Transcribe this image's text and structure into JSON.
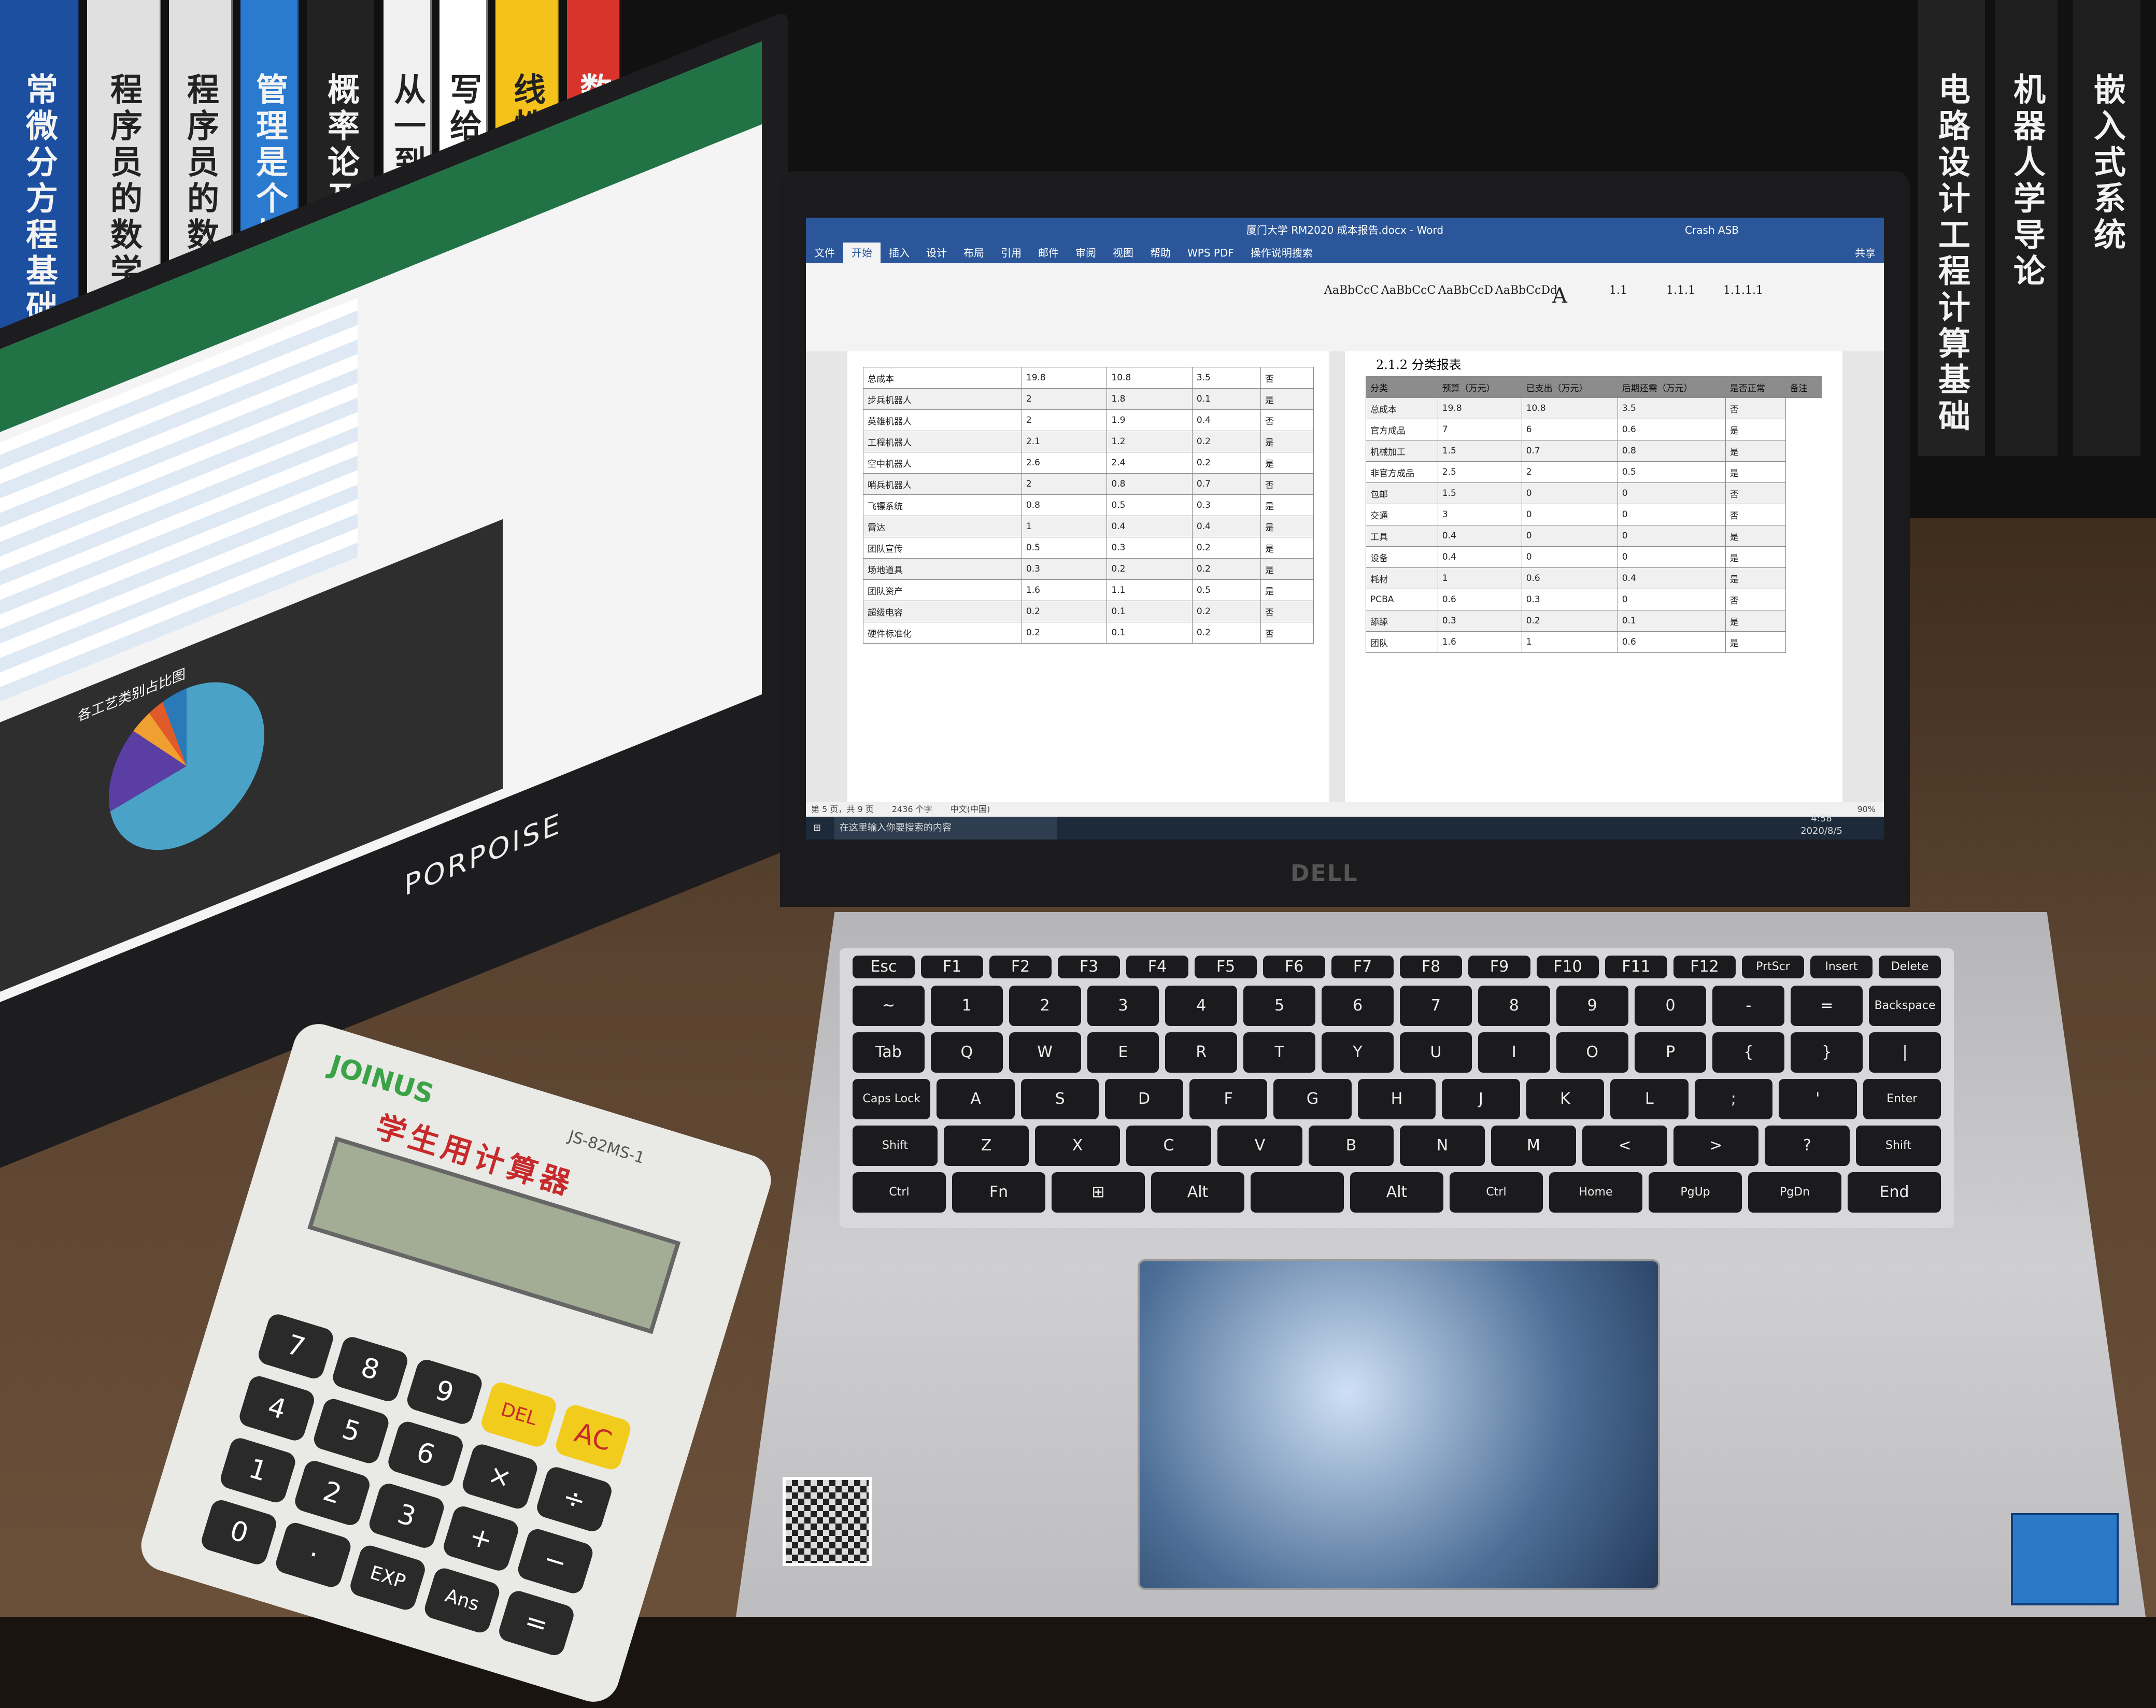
{
  "books": [
    {
      "title": "常微分方程基础",
      "color": "#1c4fa0"
    },
    {
      "title": "程序员的数学",
      "color": "#e0e0e0"
    },
    {
      "title": "程序员的数学",
      "color": "#e0e0e0"
    },
    {
      "title": "管理是个技术活",
      "color": "#2a7ad0"
    },
    {
      "title": "概率论及其应用",
      "color": "#222222"
    },
    {
      "title": "从一到无穷大",
      "color": "#f0f0f0"
    },
    {
      "title": "写给大家看的设计书",
      "color": "#ffffff"
    },
    {
      "title": "线性代数",
      "color": "#f5c21b"
    },
    {
      "title": "数学之美",
      "color": "#d9342b"
    },
    {
      "title": "电路设计工程计算基础",
      "color": "#222222"
    },
    {
      "title": "机器人学导论",
      "color": "#1e1e1e"
    },
    {
      "title": "嵌入式系统",
      "color": "#1e1e1e"
    }
  ],
  "monitor": {
    "brand": "PORPOISE",
    "chart_title": "各工艺类别占比图",
    "ribbon_color": "#217346"
  },
  "laptop": {
    "brand": "DELL",
    "window_title": "厦门大学 RM2020 成本报告.docx - Word",
    "user": "Crash ASB",
    "ribbon_tabs": [
      "文件",
      "开始",
      "插入",
      "设计",
      "布局",
      "引用",
      "邮件",
      "审阅",
      "视图",
      "帮助",
      "WPS PDF",
      "操作说明搜索"
    ],
    "share": "共享",
    "styles": [
      "AaBbCcC",
      "AaBbCcC",
      "AaBbCcD",
      "AaBbCcDd",
      "A",
      "1.1",
      "1.1.1",
      "1.1.1.1"
    ],
    "section_heading": "2.1.2 分类报表",
    "right_table_header": [
      "分类",
      "预算（万元）",
      "已支出（万元）",
      "后期还需（万元）",
      "是否正常",
      "备注"
    ],
    "left_table_rows": [
      [
        "总成本",
        "19.8",
        "10.8",
        "3.5",
        "否"
      ],
      [
        "步兵机器人",
        "2",
        "1.8",
        "0.1",
        "是"
      ],
      [
        "英雄机器人",
        "2",
        "1.9",
        "0.4",
        "否"
      ],
      [
        "工程机器人",
        "2.1",
        "1.2",
        "0.2",
        "是"
      ],
      [
        "空中机器人",
        "2.6",
        "2.4",
        "0.2",
        "是"
      ],
      [
        "哨兵机器人",
        "2",
        "0.8",
        "0.7",
        "否"
      ],
      [
        "飞镖系统",
        "0.8",
        "0.5",
        "0.3",
        "是"
      ],
      [
        "雷达",
        "1",
        "0.4",
        "0.4",
        "是"
      ],
      [
        "团队宣传",
        "0.5",
        "0.3",
        "0.2",
        "是"
      ],
      [
        "场地道具",
        "0.3",
        "0.2",
        "0.2",
        "是"
      ],
      [
        "团队资产",
        "1.6",
        "1.1",
        "0.5",
        "是"
      ],
      [
        "超级电容",
        "0.2",
        "0.1",
        "0.2",
        "否"
      ],
      [
        "硬件标准化",
        "0.2",
        "0.1",
        "0.2",
        "否"
      ]
    ],
    "right_table_rows": [
      [
        "总成本",
        "19.8",
        "10.8",
        "3.5",
        "否"
      ],
      [
        "官方成品",
        "7",
        "6",
        "0.6",
        "是"
      ],
      [
        "机械加工",
        "1.5",
        "0.7",
        "0.8",
        "是"
      ],
      [
        "非官方成品",
        "2.5",
        "2",
        "0.5",
        "是"
      ],
      [
        "包邮",
        "1.5",
        "0",
        "0",
        "否"
      ],
      [
        "交通",
        "3",
        "0",
        "0",
        "否"
      ],
      [
        "工具",
        "0.4",
        "0",
        "0",
        "是"
      ],
      [
        "设备",
        "0.4",
        "0",
        "0",
        "是"
      ],
      [
        "耗材",
        "1",
        "0.6",
        "0.4",
        "是"
      ],
      [
        "PCBA",
        "0.6",
        "0.3",
        "0",
        "否"
      ],
      [
        "舔舔",
        "0.3",
        "0.2",
        "0.1",
        "是"
      ],
      [
        "团队",
        "1.6",
        "1",
        "0.6",
        "是"
      ]
    ],
    "status_page": "第 5 页，共 9 页",
    "status_words": "2436 个字",
    "status_lang": "中文(中国)",
    "status_zoom": "90%",
    "taskbar_search": "在这里输入你要搜索的内容",
    "clock_time": "4:58",
    "clock_date": "2020/8/5"
  },
  "keyboard": {
    "row1": [
      "Esc",
      "F1",
      "F2",
      "F3",
      "F4",
      "F5",
      "F6",
      "F7",
      "F8",
      "F9",
      "F10",
      "F11",
      "F12",
      "PrtScr",
      "Insert",
      "Delete"
    ],
    "row2": [
      "~",
      "1",
      "2",
      "3",
      "4",
      "5",
      "6",
      "7",
      "8",
      "9",
      "0",
      "-",
      "=",
      "Backspace"
    ],
    "row3": [
      "Tab",
      "Q",
      "W",
      "E",
      "R",
      "T",
      "Y",
      "U",
      "I",
      "O",
      "P",
      "{",
      "}",
      "|"
    ],
    "row4": [
      "Caps Lock",
      "A",
      "S",
      "D",
      "F",
      "G",
      "H",
      "J",
      "K",
      "L",
      ";",
      "'",
      "Enter"
    ],
    "row5": [
      "Shift",
      "Z",
      "X",
      "C",
      "V",
      "B",
      "N",
      "M",
      "<",
      ">",
      "?",
      "Shift"
    ],
    "row6": [
      "Ctrl",
      "Fn",
      "⊞",
      "Alt",
      "",
      "Alt",
      "Ctrl",
      "Home",
      "PgUp",
      "PgDn",
      "End"
    ]
  },
  "calculator": {
    "brand": "JOINUS",
    "model": "JS-82MS-1",
    "title": "学生用计算器",
    "keys": [
      "7",
      "8",
      "9",
      "DEL",
      "AC",
      "4",
      "5",
      "6",
      "×",
      "÷",
      "1",
      "2",
      "3",
      "+",
      "−",
      "0",
      "·",
      "EXP",
      "Ans",
      "="
    ]
  }
}
